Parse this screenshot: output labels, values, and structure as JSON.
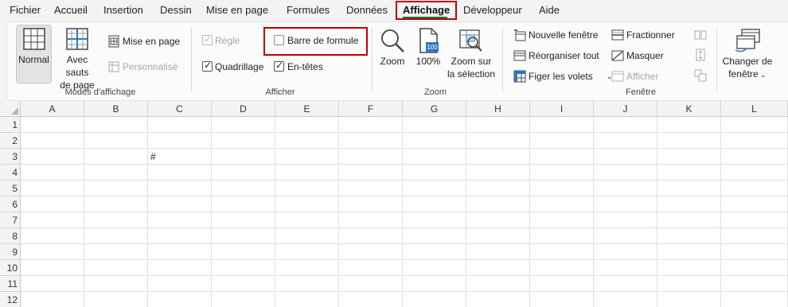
{
  "menu": {
    "tabs": [
      "Fichier",
      "Accueil",
      "Insertion",
      "Dessin",
      "Mise en page",
      "Formules",
      "Données",
      "Affichage",
      "Développeur",
      "Aide"
    ],
    "active": "Affichage"
  },
  "ribbon": {
    "modes": {
      "label": "Modes d'affichage",
      "normal": "Normal",
      "sauts_line1": "Avec sauts",
      "sauts_line2": "de page",
      "mise_en_page": "Mise en page",
      "personnalise": "Personnalisé"
    },
    "afficher": {
      "label": "Afficher",
      "regle": {
        "text": "Règle",
        "checked": true,
        "disabled": true
      },
      "quadrillage": {
        "text": "Quadrillage",
        "checked": true,
        "disabled": false
      },
      "barre_formule": {
        "text": "Barre de formule",
        "checked": false,
        "disabled": false
      },
      "en_tetes": {
        "text": "En-têtes",
        "checked": true,
        "disabled": false
      }
    },
    "zoom": {
      "label": "Zoom",
      "zoom": "Zoom",
      "hundred": "100%",
      "hundred_icon_text": "100",
      "selection_line1": "Zoom sur",
      "selection_line2": "la sélection"
    },
    "fenetre": {
      "label": "Fenêtre",
      "nouvelle": "Nouvelle fenêtre",
      "reorganiser": "Réorganiser tout",
      "figer": "Figer les volets",
      "fractionner": "Fractionner",
      "masquer": "Masquer",
      "afficher": "Afficher",
      "changer_line1": "Changer de",
      "changer_line2": "fenêtre"
    }
  },
  "sheet": {
    "columns": [
      "A",
      "B",
      "C",
      "D",
      "E",
      "F",
      "G",
      "H",
      "I",
      "J",
      "K",
      "L"
    ],
    "rows": [
      "1",
      "2",
      "3",
      "4",
      "5",
      "6",
      "7",
      "8",
      "9",
      "10",
      "11",
      "12"
    ],
    "cells": [
      {
        "col": "C",
        "row": "3",
        "value": "#"
      }
    ]
  },
  "colors": {
    "accent": "#1e7145",
    "highlight": "#c00000"
  }
}
